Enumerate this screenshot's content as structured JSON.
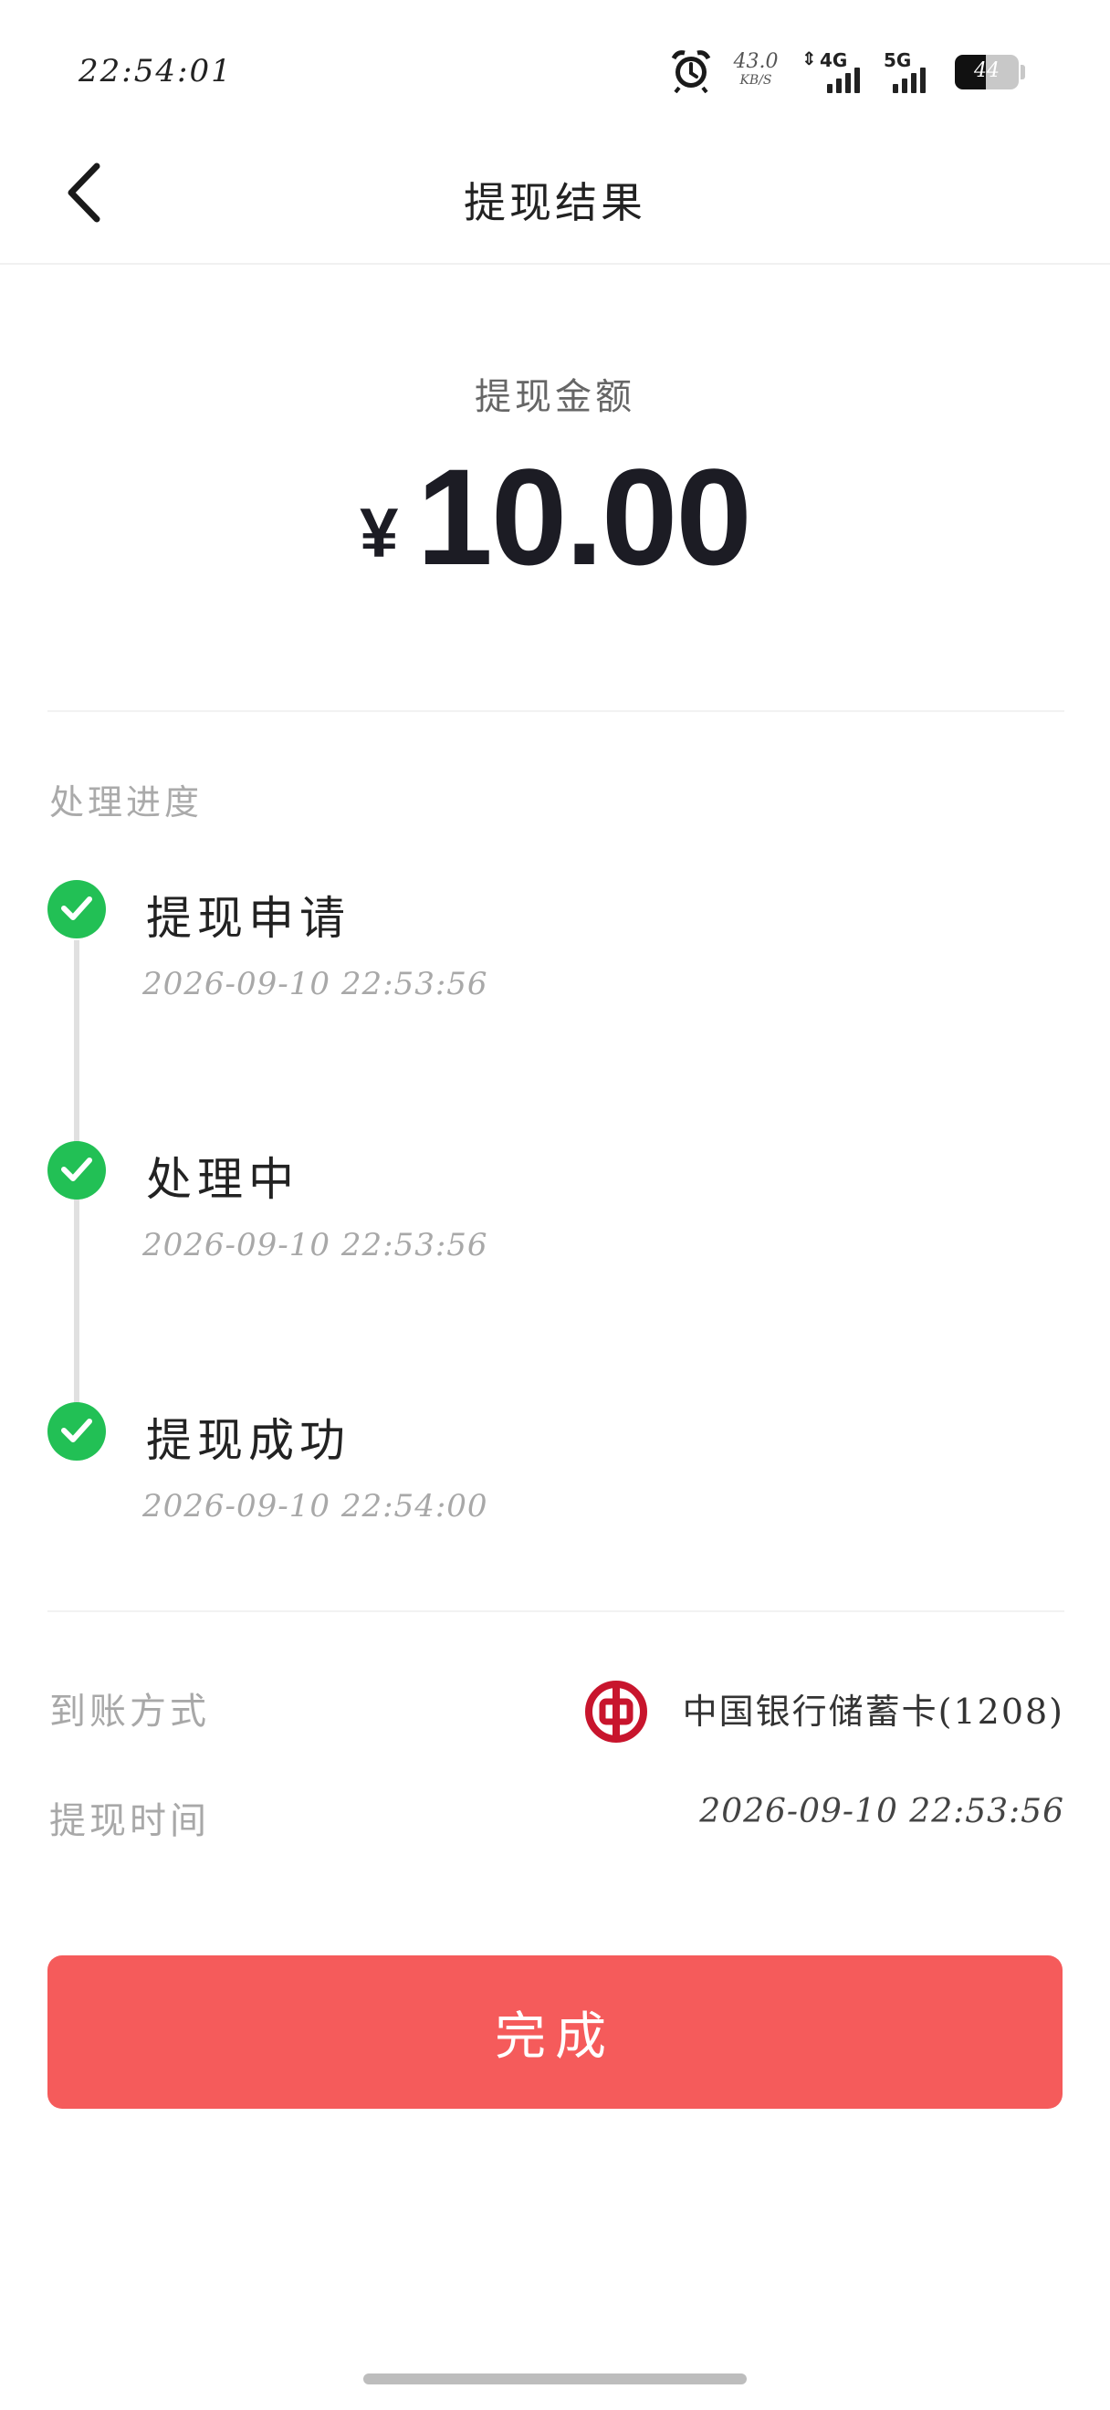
{
  "status_bar": {
    "time": "22:54:01",
    "net_speed_value": "43.0",
    "net_speed_unit": "KB/S",
    "net_label_1": "4G",
    "net_label_2": "5G",
    "battery": "44"
  },
  "nav": {
    "title": "提现结果"
  },
  "amount": {
    "label": "提现金额",
    "currency": "¥",
    "value": "10.00"
  },
  "progress": {
    "title": "处理进度",
    "steps": [
      {
        "title": "提现申请",
        "time": "2026-09-10  22:53:56"
      },
      {
        "title": "处理中",
        "time": "2026-09-10  22:53:56"
      },
      {
        "title": "提现成功",
        "time": "2026-09-10  22:54:00"
      }
    ]
  },
  "info": {
    "method_label": "到账方式",
    "method_value": "中国银行储蓄卡(1208)",
    "time_label": "提现时间",
    "time_value": "2026-09-10  22:53:56"
  },
  "actions": {
    "done_label": "完成"
  },
  "colors": {
    "accent": "#f55b5b",
    "success": "#22c055",
    "bank_red": "#c8152d"
  }
}
